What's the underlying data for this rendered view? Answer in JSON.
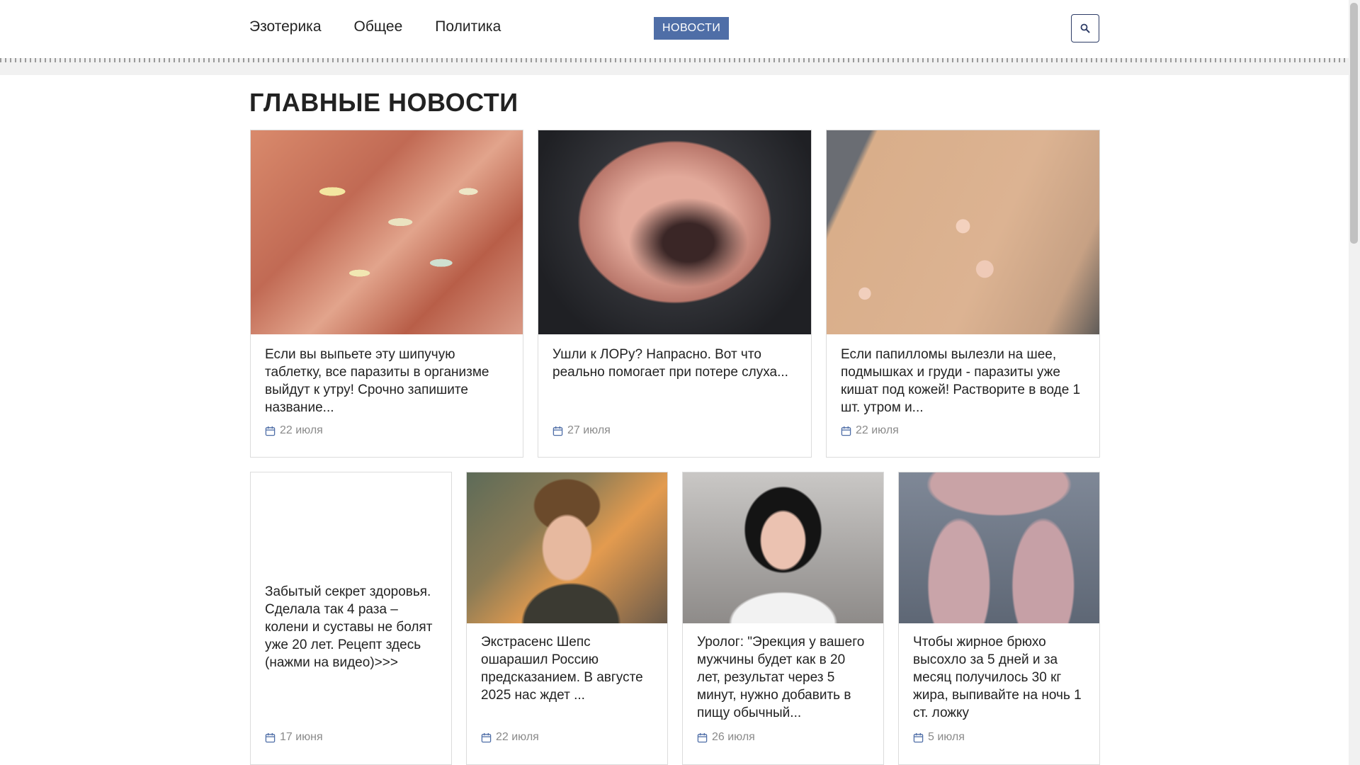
{
  "nav": {
    "items": [
      {
        "label": "Эзотерика"
      },
      {
        "label": "Общее"
      },
      {
        "label": "Политика"
      }
    ],
    "news_button": "НОВОСТИ",
    "search_icon": "search-icon"
  },
  "main": {
    "title": "ГЛАВНЫЕ НОВОСТИ",
    "cards": [
      {
        "title": "Если вы выпьете эту шипучую таблетку, все паразиты в организме выйдут к утру! Срочно запишите название...",
        "date": "22 июля",
        "image": "fingers with parasites"
      },
      {
        "title": "Ушли к ЛОРу? Напрасно. Вот что реально помогает при потере слуха...",
        "date": "27 июля",
        "image": "ear"
      },
      {
        "title": "Если папилломы вылезли на шее, подмышках и груди - паразиты уже кишат под кожей! Растворите в воде 1 шт. утром и...",
        "date": "22 июля",
        "image": "skin with papillomas"
      },
      {
        "title": "Забытый секрет здоровья. Сделала так 4 раза – колени и суставы не болят уже 20 лет. Рецепт здесь (нажми на видео)>>>",
        "date": "17 июня",
        "image": ""
      },
      {
        "title": "Экстрасенс Шепс ошарашил Россию предсказанием. В августе 2025 нас ждет ...",
        "date": "22 июля",
        "image": "man portrait"
      },
      {
        "title": "Уролог: \"Эрекция у вашего мужчины будет как в 20 лет, результат через 5 минут, нужно добавить в пищу обычный...",
        "date": "26 июля",
        "image": "woman in gloves"
      },
      {
        "title": "Чтобы жирное брюхо высохло за 5 дней и за месяц получилось 30 кг жира, выпивайте на ночь 1 ст. ложку",
        "date": "5 июля",
        "image": "legs"
      }
    ],
    "calendar_icon": "calendar-icon"
  }
}
